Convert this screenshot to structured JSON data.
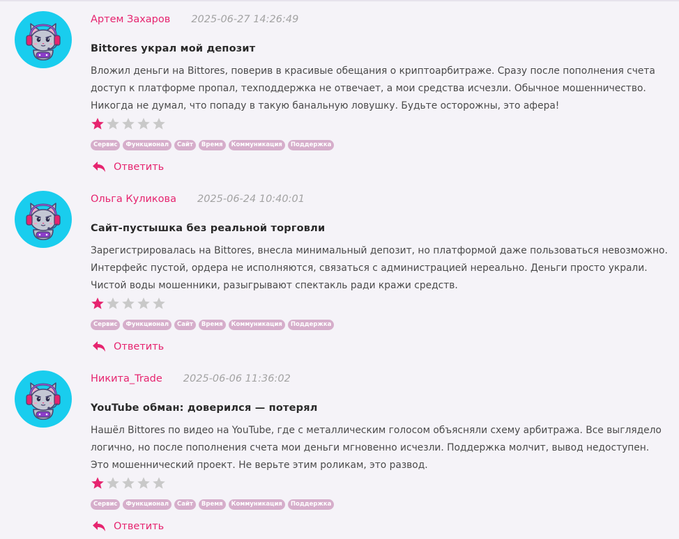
{
  "colors": {
    "accent": "#e6246f",
    "avatar_bg": "#19cdee",
    "tag_bg": "#d6aecb",
    "star_filled": "#e6246f",
    "star_empty": "#c9c9c9"
  },
  "reviews": [
    {
      "author": "Артем Захаров",
      "date": "2025-06-27 14:26:49",
      "title": "Bittores украл мой депозит",
      "text": "Вложил деньги на Bittores, поверив в красивые обещания о криптоарбитраже. Сразу после пополнения счета доступ к платформе пропал, техподдержка не отвечает, а мои средства исчезли. Обычное мошенничество. Никогда не думал, что попаду в такую банальную ловушку. Будьте осторожны, это афера!",
      "rating": 1,
      "rating_max": 5,
      "tags": [
        "Сервис",
        "Функционал",
        "Сайт",
        "Время",
        "Коммуникация",
        "Поддержка"
      ],
      "reply_label": "Ответить",
      "avatar_icon": "cat-gamer-avatar-icon"
    },
    {
      "author": "Ольга Куликова",
      "date": "2025-06-24 10:40:01",
      "title": "Сайт-пустышка без реальной торговли",
      "text": "Зарегистрировалась на Bittores, внесла минимальный депозит, но платформой даже пользоваться невозможно. Интерфейс пустой, ордера не исполняются, связаться с администрацией нереально. Деньги просто украли. Чистой воды мошенники, разыгрывают спектакль ради кражи средств.",
      "rating": 1,
      "rating_max": 5,
      "tags": [
        "Сервис",
        "Функционал",
        "Сайт",
        "Время",
        "Коммуникация",
        "Поддержка"
      ],
      "reply_label": "Ответить",
      "avatar_icon": "cat-gamer-avatar-icon"
    },
    {
      "author": "Никита_Trade",
      "date": "2025-06-06 11:36:02",
      "title": "YouTube обман: доверился — потерял",
      "text": "Нашёл Bittores по видео на YouTube, где с металлическим голосом объясняли схему арбитража. Все выглядело логично, но после пополнения счета мои деньги мгновенно исчезли. Поддержка молчит, вывод недоступен. Это мошеннический проект. Не верьте этим роликам, это развод.",
      "rating": 1,
      "rating_max": 5,
      "tags": [
        "Сервис",
        "Функционал",
        "Сайт",
        "Время",
        "Коммуникация",
        "Поддержка"
      ],
      "reply_label": "Ответить",
      "avatar_icon": "cat-gamer-avatar-icon"
    }
  ]
}
